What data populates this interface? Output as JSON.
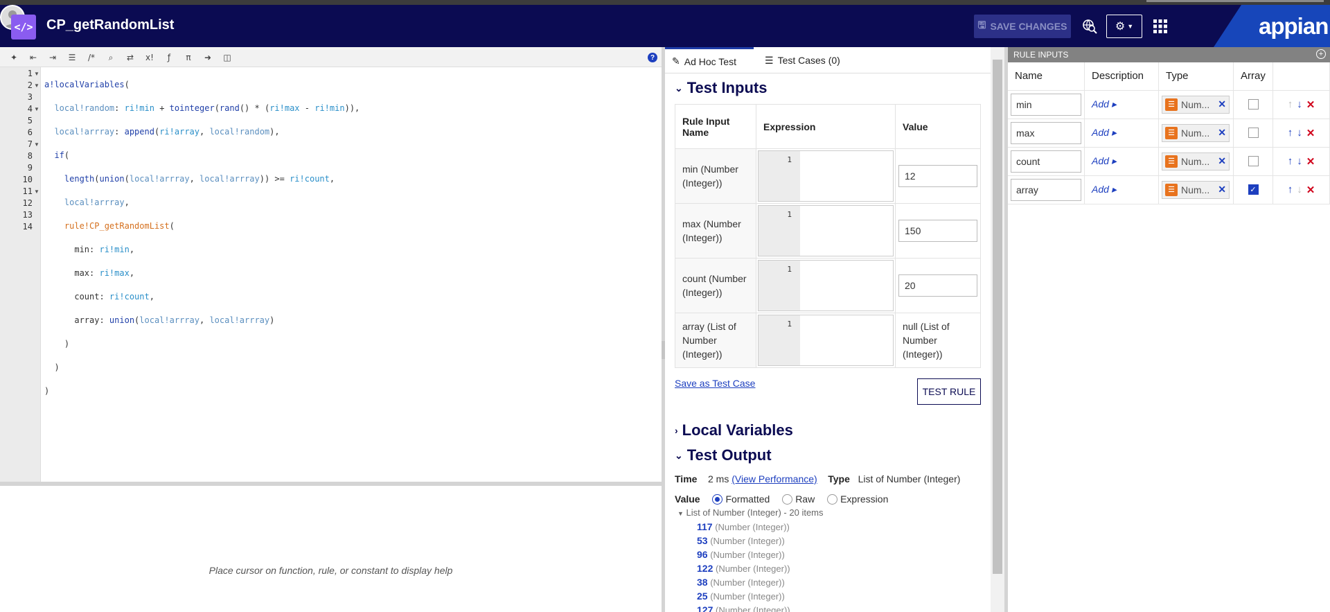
{
  "header": {
    "rule_name": "CP_getRandomList",
    "save_label": "SAVE CHANGES",
    "logo": "appian"
  },
  "editor": {
    "help_text": "Place cursor on function, rule, or constant to display help",
    "toolbar_icons": [
      "format-icon",
      "outdent-icon",
      "indent-icon",
      "list-icon",
      "comment-icon",
      "search-icon",
      "shuffle-icon",
      "factorial-icon",
      "function-icon",
      "pi-icon",
      "export-icon",
      "find-icon"
    ],
    "line_numbers": [
      "1",
      "2",
      "3",
      "4",
      "5",
      "6",
      "7",
      "8",
      "9",
      "10",
      "11",
      "12",
      "13",
      "14"
    ]
  },
  "tabs": {
    "adhoc": "Ad Hoc Test",
    "cases": "Test Cases (0)"
  },
  "test_inputs": {
    "title": "Test Inputs",
    "col_name": "Rule Input Name",
    "col_expr": "Expression",
    "col_value": "Value",
    "rows": [
      {
        "name": "min (Number (Integer))",
        "line": "1",
        "value": "12"
      },
      {
        "name": "max (Number (Integer))",
        "line": "1",
        "value": "150"
      },
      {
        "name": "count (Number (Integer))",
        "line": "1",
        "value": "20"
      },
      {
        "name": "array (List of Number (Integer))",
        "line": "1",
        "value": "null (List of Number (Integer))"
      }
    ],
    "save_case": "Save as Test Case",
    "test_rule": "TEST RULE"
  },
  "local_variables": {
    "title": "Local Variables"
  },
  "test_output": {
    "title": "Test Output",
    "time_label": "Time",
    "time_value": "2 ms",
    "view_perf": "(View Performance)",
    "type_label": "Type",
    "type_value": "List of Number (Integer)",
    "value_label": "Value",
    "modes": [
      "Formatted",
      "Raw",
      "Expression"
    ],
    "selected_mode": "Formatted",
    "list_header": "List of Number (Integer) - 20 items",
    "item_type": "(Number (Integer))",
    "items": [
      "117",
      "53",
      "96",
      "122",
      "38",
      "25",
      "127"
    ]
  },
  "rule_inputs": {
    "title": "RULE INPUTS",
    "col_name": "Name",
    "col_desc": "Description",
    "col_type": "Type",
    "col_array": "Array",
    "add_label": "Add",
    "type_label": "Num...",
    "rows": [
      {
        "name": "min",
        "array": false
      },
      {
        "name": "max",
        "array": false
      },
      {
        "name": "count",
        "array": false
      },
      {
        "name": "array",
        "array": true
      }
    ]
  },
  "colors": {
    "header_bg": "#0b0b52",
    "accent": "#1d3fbf",
    "code_icon": "#8a5cf0",
    "type_icon": "#e8731e",
    "delete": "#d0021b"
  }
}
